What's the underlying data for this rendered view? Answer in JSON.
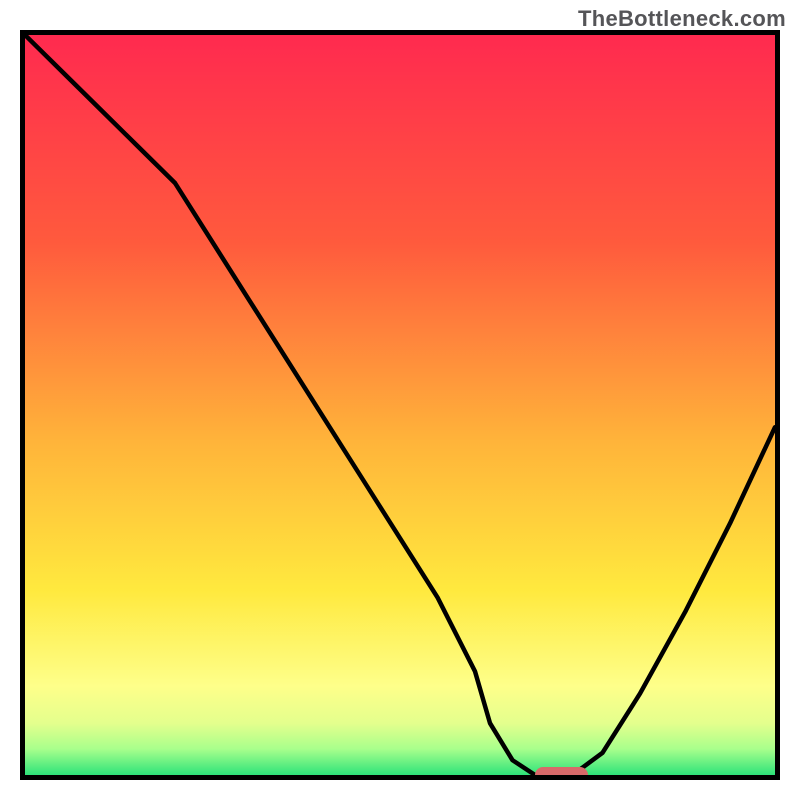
{
  "watermark": {
    "text": "TheBottleneck.com"
  },
  "chart_data": {
    "type": "line",
    "title": "",
    "xlabel": "",
    "ylabel": "",
    "xlim": [
      0,
      100
    ],
    "ylim": [
      0,
      100
    ],
    "series": [
      {
        "name": "bottleneck-curve",
        "x": [
          0,
          5,
          10,
          15,
          20,
          25,
          30,
          35,
          40,
          45,
          50,
          55,
          60,
          62,
          65,
          68,
          70,
          73,
          77,
          82,
          88,
          94,
          100
        ],
        "values": [
          100,
          95,
          90,
          85,
          80,
          72,
          64,
          56,
          48,
          40,
          32,
          24,
          14,
          7,
          2,
          0,
          0,
          0,
          3,
          11,
          22,
          34,
          47
        ]
      }
    ],
    "marker": {
      "x_start": 68,
      "x_end": 75,
      "y": 0,
      "color": "#d86a6a"
    },
    "background_gradient": [
      {
        "stop": 0.0,
        "color": "#ff2a4f"
      },
      {
        "stop": 0.28,
        "color": "#ff5a3d"
      },
      {
        "stop": 0.55,
        "color": "#ffb43a"
      },
      {
        "stop": 0.75,
        "color": "#ffe93e"
      },
      {
        "stop": 0.88,
        "color": "#feff8a"
      },
      {
        "stop": 0.93,
        "color": "#e4ff8d"
      },
      {
        "stop": 0.965,
        "color": "#a8ff8c"
      },
      {
        "stop": 1.0,
        "color": "#2ee37a"
      }
    ]
  }
}
